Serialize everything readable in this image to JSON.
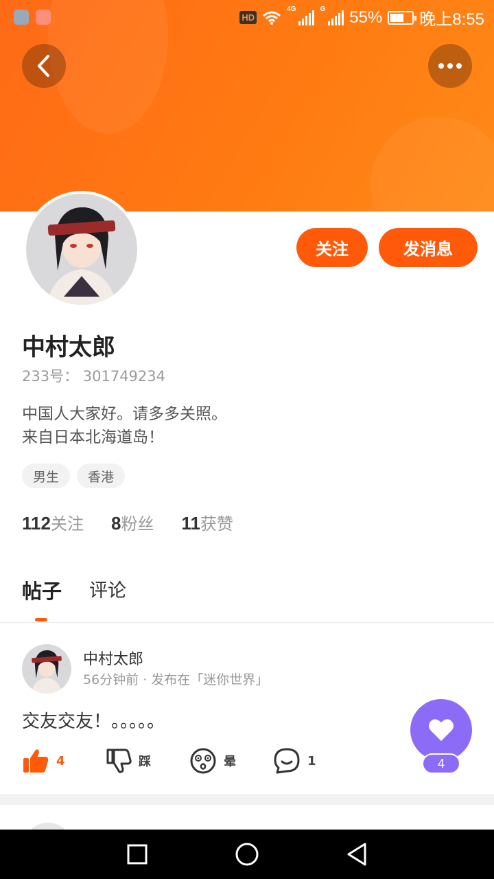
{
  "status_bar": {
    "hd_label": "HD",
    "net1": "4G",
    "net2": "G",
    "battery_percent": "55%",
    "time": "晚上8:55"
  },
  "header": {
    "back_icon": "chevron-left-icon",
    "more_icon": "more-horizontal-icon"
  },
  "profile": {
    "name": "中村太郎",
    "uid_text": "233号：  301749234",
    "bio_line1": "中国人大家好。请多多关照。",
    "bio_line2": "来自日本北海道岛！",
    "tags": [
      "男生",
      "香港"
    ],
    "follow_label": "关注",
    "message_label": "发消息",
    "stats": [
      {
        "num": "112",
        "label": "关注"
      },
      {
        "num": "8",
        "label": "粉丝"
      },
      {
        "num": "11",
        "label": "获赞"
      }
    ]
  },
  "tabs": [
    {
      "label": "帖子",
      "active": true
    },
    {
      "label": "评论",
      "active": false
    }
  ],
  "post": {
    "author": "中村太郎",
    "meta": "56分钟前 · 发布在「迷你世界」",
    "text": "交友交友！。。。。。",
    "actions": {
      "like": {
        "icon": "thumbs-up-icon",
        "count": "4"
      },
      "dislike": {
        "icon": "thumbs-down-icon",
        "label": "踩"
      },
      "dizzy": {
        "icon": "dizzy-face-icon",
        "label": "晕"
      },
      "comment": {
        "icon": "comment-icon",
        "count": "1"
      }
    }
  },
  "heart_fab": {
    "icon": "heart-icon",
    "count": "4"
  },
  "colors": {
    "accent": "#ff5a0a",
    "banner": "#ff7a12",
    "fab": "#8c6cf7"
  }
}
